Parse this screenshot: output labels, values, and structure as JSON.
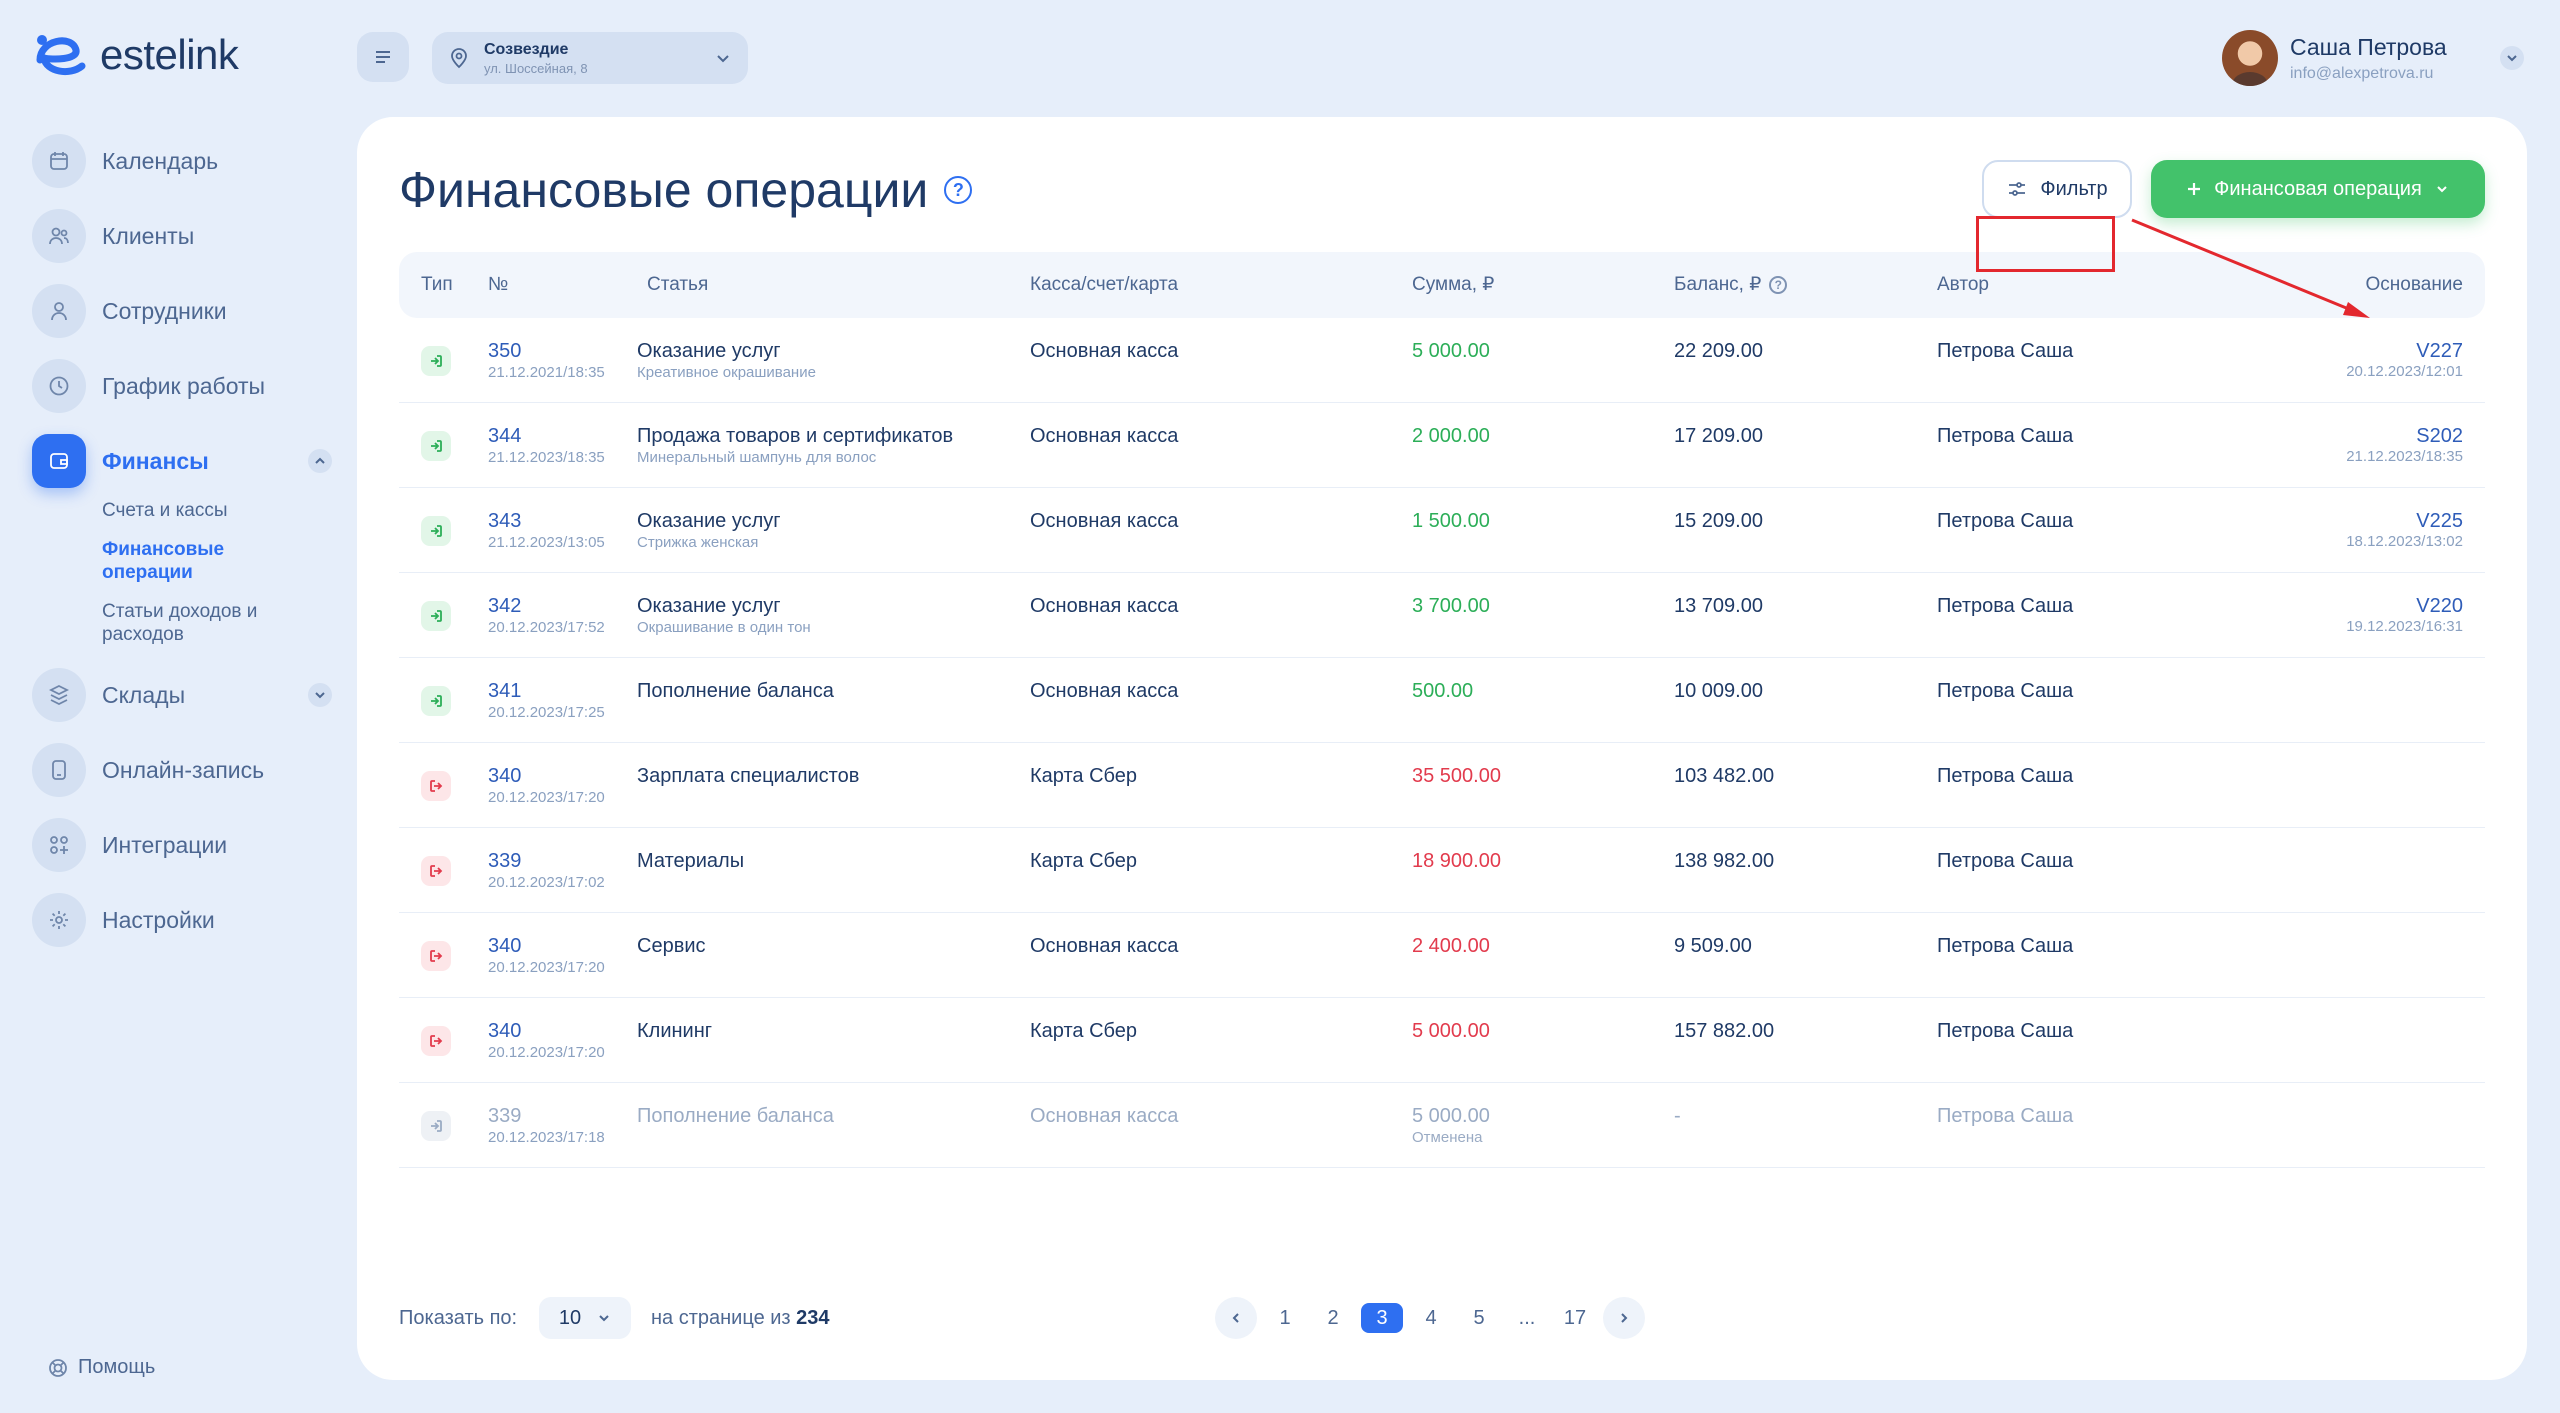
{
  "app": {
    "logo_text": "estelink"
  },
  "sidebar": {
    "items": [
      {
        "label": "Календарь"
      },
      {
        "label": "Клиенты"
      },
      {
        "label": "Сотрудники"
      },
      {
        "label": "График работы"
      },
      {
        "label": "Финансы"
      },
      {
        "label": "Склады"
      },
      {
        "label": "Онлайн-запись"
      },
      {
        "label": "Интеграции"
      },
      {
        "label": "Настройки"
      }
    ],
    "finance_sub": [
      {
        "label": "Счета и кассы"
      },
      {
        "label": "Финансовые операции"
      },
      {
        "label": "Статьи доходов и расходов"
      }
    ],
    "help_label": "Помощь"
  },
  "topbar": {
    "location_name": "Созвездие",
    "location_address": "ул. Шоссейная, 8",
    "user_name": "Саша Петрова",
    "user_email": "info@alexpetrova.ru"
  },
  "page": {
    "title": "Финансовые операции",
    "filter_label": "Фильтр",
    "add_label": "Финансовая операция"
  },
  "table": {
    "headers": {
      "type": "Тип",
      "number": "№",
      "article": "Статья",
      "cash": "Касса/счет/карта",
      "sum": "Сумма, ₽",
      "balance": "Баланс, ₽",
      "author": "Автор",
      "basis": "Основание"
    },
    "rows": [
      {
        "id": "350",
        "date": "21.12.2021/18:35",
        "article": "Оказание услуг",
        "article_sub": "Креативное окрашивание",
        "cash": "Основная касса",
        "sum": "5 000.00",
        "sum_sub": "",
        "balance": "22 209.00",
        "author": "Петрова Саша",
        "basis_id": "V227",
        "basis_date": "20.12.2023/12:01"
      },
      {
        "id": "344",
        "date": "21.12.2023/18:35",
        "article": "Продажа товаров и сертификатов",
        "article_sub": "Минеральный шампунь для волос",
        "cash": "Основная касса",
        "sum": "2 000.00",
        "sum_sub": "",
        "balance": "17 209.00",
        "author": "Петрова Саша",
        "basis_id": "S202",
        "basis_date": "21.12.2023/18:35"
      },
      {
        "id": "343",
        "date": "21.12.2023/13:05",
        "article": "Оказание услуг",
        "article_sub": "Стрижка женская",
        "cash": "Основная касса",
        "sum": "1 500.00",
        "sum_sub": "",
        "balance": "15 209.00",
        "author": "Петрова Саша",
        "basis_id": "V225",
        "basis_date": "18.12.2023/13:02"
      },
      {
        "id": "342",
        "date": "20.12.2023/17:52",
        "article": "Оказание услуг",
        "article_sub": "Окрашивание в один тон",
        "cash": "Основная касса",
        "sum": "3 700.00",
        "sum_sub": "",
        "balance": "13 709.00",
        "author": "Петрова Саша",
        "basis_id": "V220",
        "basis_date": "19.12.2023/16:31"
      },
      {
        "id": "341",
        "date": "20.12.2023/17:25",
        "article": "Пополнение баланса",
        "article_sub": "",
        "cash": "Основная касса",
        "sum": "500.00",
        "sum_sub": "",
        "balance": "10 009.00",
        "author": "Петрова Саша",
        "basis_id": "",
        "basis_date": ""
      },
      {
        "id": "340",
        "date": "20.12.2023/17:20",
        "article": "Зарплата специалистов",
        "article_sub": "",
        "cash": "Карта Сбер",
        "sum": "35 500.00",
        "sum_sub": "",
        "balance": "103 482.00",
        "author": "Петрова Саша",
        "basis_id": "",
        "basis_date": ""
      },
      {
        "id": "339",
        "date": "20.12.2023/17:02",
        "article": "Материалы",
        "article_sub": "",
        "cash": "Карта Сбер",
        "sum": "18 900.00",
        "sum_sub": "",
        "balance": "138 982.00",
        "author": "Петрова Саша",
        "basis_id": "",
        "basis_date": ""
      },
      {
        "id": "340",
        "date": "20.12.2023/17:20",
        "article": "Сервис",
        "article_sub": "",
        "cash": "Основная касса",
        "sum": "2 400.00",
        "sum_sub": "",
        "balance": "9 509.00",
        "author": "Петрова Саша",
        "basis_id": "",
        "basis_date": ""
      },
      {
        "id": "340",
        "date": "20.12.2023/17:20",
        "article": "Клининг",
        "article_sub": "",
        "cash": "Карта Сбер",
        "sum": "5 000.00",
        "sum_sub": "",
        "balance": "157 882.00",
        "author": "Петрова Саша",
        "basis_id": "",
        "basis_date": ""
      },
      {
        "id": "339",
        "date": "20.12.2023/17:18",
        "article": "Пополнение баланса",
        "article_sub": "",
        "cash": "Основная касса",
        "sum": "5 000.00",
        "sum_sub": "Отменена",
        "balance": "-",
        "author": "Петрова Саша",
        "basis_id": "",
        "basis_date": ""
      }
    ]
  },
  "footer": {
    "show_label": "Показать по:",
    "per_page": "10",
    "of_text": "на странице из",
    "total": "234",
    "pages": [
      "1",
      "2",
      "3",
      "4",
      "5",
      "...",
      "17"
    ],
    "current_page": "3"
  },
  "colors": {
    "accent": "#2e6ff1",
    "income": "#2cae58",
    "expense": "#e23b4d",
    "add_button": "#43c26b",
    "annotation": "#e3282e"
  }
}
